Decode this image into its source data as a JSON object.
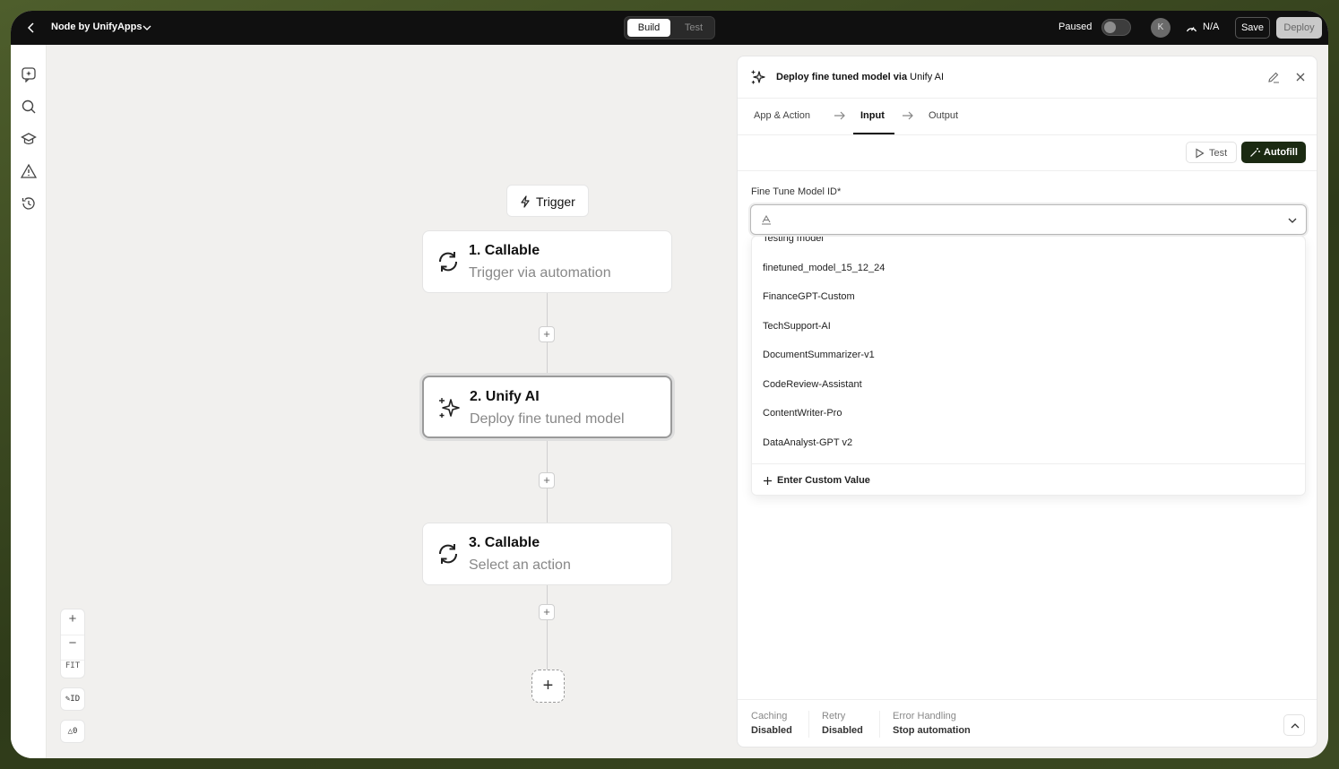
{
  "app": {
    "title": "Node by UnifyApps"
  },
  "topbar": {
    "mode_build": "Build",
    "mode_test": "Test",
    "paused_label": "Paused",
    "avatar_initial": "K",
    "credits_label": "N/A",
    "save_label": "Save",
    "deploy_label": "Deploy"
  },
  "canvas": {
    "trigger_label": "Trigger",
    "nodes": [
      {
        "title": "1. Callable",
        "subtitle": "Trigger via automation"
      },
      {
        "title": "2. Unify AI",
        "subtitle": "Deploy fine tuned model"
      },
      {
        "title": "3. Callable",
        "subtitle": "Select an action"
      }
    ],
    "zoom_in": "+",
    "zoom_out": "−",
    "zoom_fit": "FIT",
    "id_toggle": "ID",
    "warnings_count": "0"
  },
  "panel": {
    "title_prefix": "Deploy fine tuned model via",
    "title_app": "Unify AI",
    "tabs": [
      {
        "label": "App & Action"
      },
      {
        "label": "Input"
      },
      {
        "label": "Output"
      }
    ],
    "test_label": "Test",
    "autofill_label": "Autofill",
    "field_label": "Fine Tune Model ID*",
    "dropdown_options": [
      "Testing model",
      "finetuned_model_15_12_24",
      "FinanceGPT-Custom",
      "TechSupport-AI",
      "DocumentSummarizer-v1",
      "CodeReview-Assistant",
      "ContentWriter-Pro",
      "DataAnalyst-GPT v2"
    ],
    "custom_value_label": "Enter Custom Value",
    "footer": [
      {
        "label": "Caching",
        "value": "Disabled"
      },
      {
        "label": "Retry",
        "value": "Disabled"
      },
      {
        "label": "Error Handling",
        "value": "Stop automation"
      }
    ]
  }
}
